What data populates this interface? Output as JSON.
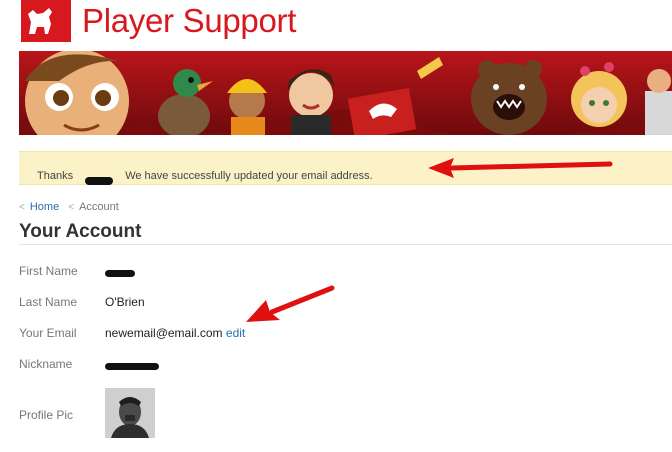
{
  "header": {
    "logo_text": "zynga",
    "title": "Player Support"
  },
  "notice": {
    "prefix": "Thanks",
    "message": "We have successfully updated your email address."
  },
  "breadcrumb": {
    "home": "Home",
    "current": "Account"
  },
  "page": {
    "title": "Your Account"
  },
  "account": {
    "first_name_label": "First Name",
    "last_name_label": "Last Name",
    "last_name_value": "O'Brien",
    "email_label": "Your Email",
    "email_value": "newemail@email.com",
    "email_edit": "edit",
    "nickname_label": "Nickname",
    "profile_pic_label": "Profile Pic"
  },
  "colors": {
    "brand": "#d7191f",
    "notice_bg": "#fbf3c7",
    "link": "#2b6cb0",
    "arrow": "#e01010"
  }
}
